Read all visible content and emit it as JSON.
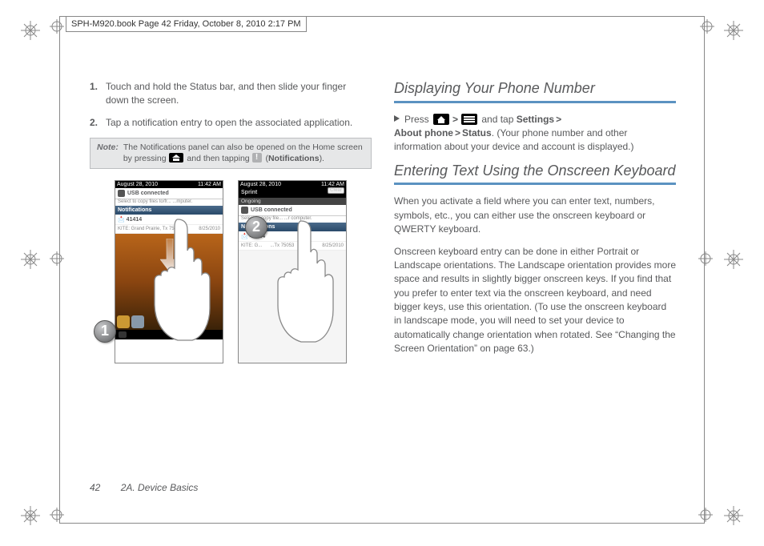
{
  "header": "SPH-M920.book  Page 42  Friday, October 8, 2010  2:17 PM",
  "left": {
    "step1_num": "1.",
    "step1": "Touch and hold the Status bar, and then slide your finger down the screen.",
    "step2_num": "2.",
    "step2": "Tap a notification entry to open the associated application.",
    "note_label": "Note:",
    "note_a": "The Notifications panel can also be opened on the Home screen by pressing ",
    "note_b": " and then tapping ",
    "note_c": "Notifications",
    "note_d": ").",
    "phone_date": "August 28, 2010",
    "phone_time": "11:42 AM",
    "usb_title": "USB connected",
    "usb_sub1": "Select to copy files to/fr...           ...mputer.",
    "notif_title": "Notifications",
    "notif_row1_l": "41414",
    "notif_row1_sub": "KITE: Grand Prairie, Tx 750...",
    "notif_row1_r": "8/25/2010",
    "badge1": "1",
    "badge2": "2",
    "sprint": "Sprint",
    "clear": "Clear",
    "ongoing": "Ongoing",
    "usb2_title": "USB connected",
    "usb2_sub": "Select to copy file...          ...r computer.",
    "notif2_row1_l": "41414",
    "notif2_row1_sub_l": "KITE: G...",
    "notif2_row1_sub_r": "...Tx 75053",
    "notif2_row1_r": "8/25/2010"
  },
  "right": {
    "heading1": "Displaying Your Phone Number",
    "press": "Press ",
    "tap": " and tap ",
    "settings": "Settings",
    "about": "About phone",
    "status": "Status",
    "tail": ". (Your phone number and other information about your device and account is displayed.)",
    "heading2": "Entering Text Using the Onscreen Keyboard",
    "p1": "When you activate a field where you can enter text, numbers, symbols, etc., you can either use the onscreen keyboard or QWERTY keyboard.",
    "p2": "Onscreen keyboard entry can be done in either Portrait or Landscape orientations. The Landscape orientation provides more space and results in slightly bigger onscreen keys. If you find that you prefer to enter text via the onscreen keyboard, and need bigger keys, use this orientation. (To use the onscreen keyboard in landscape mode, you will need to set your device to automatically change orientation when rotated. See “Changing the Screen Orientation” on page 63.)"
  },
  "footer": {
    "page": "42",
    "section": "2A. Device Basics"
  }
}
